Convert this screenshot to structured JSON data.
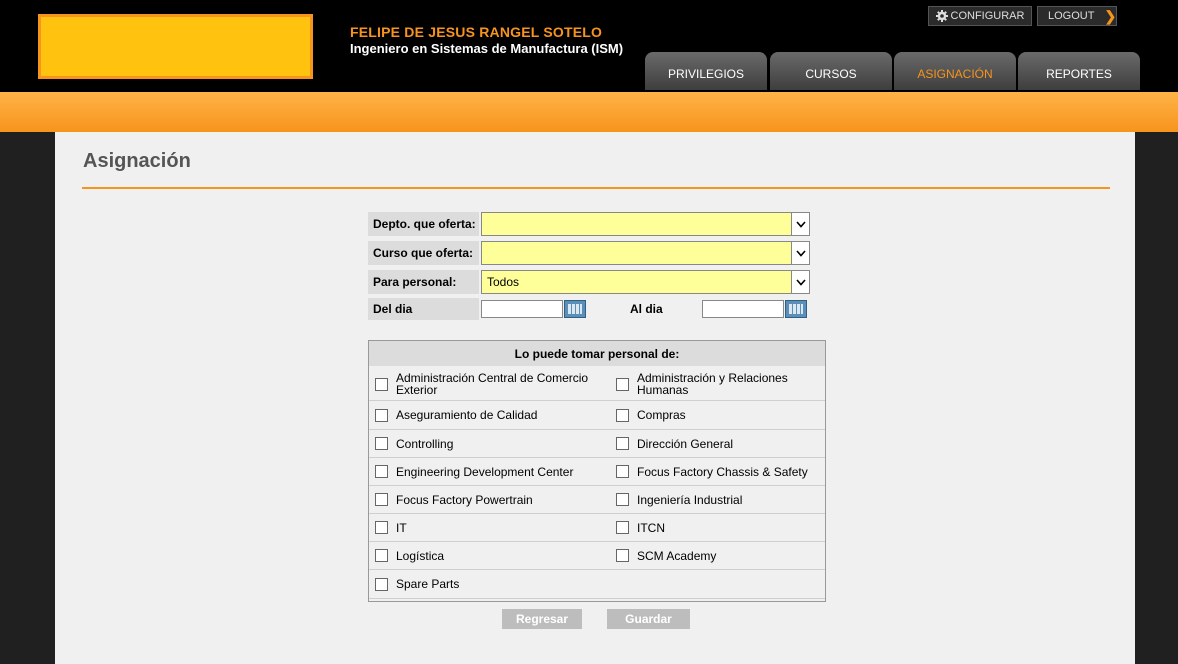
{
  "user": {
    "name": "FELIPE DE JESUS RANGEL SOTELO",
    "role": "Ingeniero en Sistemas de Manufactura (ISM)"
  },
  "top_actions": {
    "configurar": "CONFIGURAR",
    "logout": "LOGOUT"
  },
  "tabs": [
    {
      "label": "PRIVILEGIOS",
      "active": false
    },
    {
      "label": "CURSOS",
      "active": false
    },
    {
      "label": "ASIGNACIÓN",
      "active": true
    },
    {
      "label": "REPORTES",
      "active": false
    }
  ],
  "page": {
    "title": "Asignación"
  },
  "form": {
    "depto_label": "Depto. que oferta:",
    "depto_value": "",
    "curso_label": "Curso que oferta:",
    "curso_value": "",
    "personal_label": "Para personal:",
    "personal_value": "Todos",
    "del_dia_label": "Del dia",
    "al_dia_label": "Al dia"
  },
  "options_box": {
    "header": "Lo puede tomar personal de:",
    "options": [
      "Administración Central de Comercio Exterior",
      "Administración y Relaciones Humanas",
      "Aseguramiento de Calidad",
      "Compras",
      "Controlling",
      "Dirección General",
      "Engineering Development Center",
      "Focus Factory Chassis & Safety",
      "Focus Factory Powertrain",
      "Ingeniería Industrial",
      "IT",
      "ITCN",
      "Logística",
      "SCM Academy",
      "Spare Parts"
    ]
  },
  "buttons": {
    "regresar": "Regresar",
    "guardar": "Guardar"
  },
  "colors": {
    "accent": "#f7941d",
    "logo": "#ffc20e",
    "select_bg": "#ffff99"
  }
}
